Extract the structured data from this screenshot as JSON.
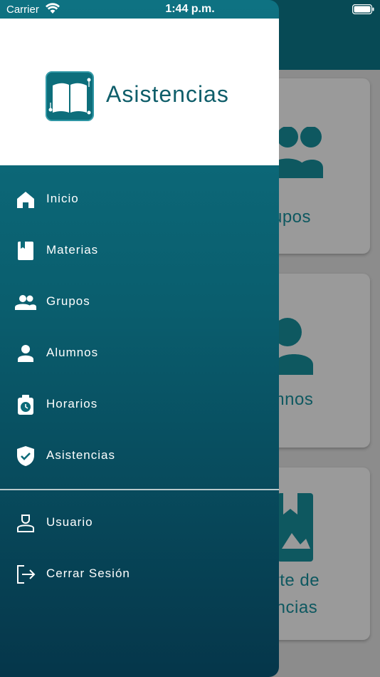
{
  "status_bar": {
    "carrier": "Carrier",
    "time": "1:44 p.m."
  },
  "app": {
    "title": "Asistencias",
    "brand_color": "#0f5e6a",
    "drawer_gradient": [
      "#0e7282",
      "#05364a"
    ]
  },
  "drawer": {
    "items": [
      {
        "label": "Inicio",
        "icon": "home-icon"
      },
      {
        "label": "Materias",
        "icon": "book-icon"
      },
      {
        "label": "Grupos",
        "icon": "group-icon"
      },
      {
        "label": "Alumnos",
        "icon": "person-icon"
      },
      {
        "label": "Horarios",
        "icon": "schedule-icon"
      },
      {
        "label": "Asistencias",
        "icon": "verified-shield-icon"
      }
    ],
    "secondary_items": [
      {
        "label": "Usuario",
        "icon": "user-badge-icon"
      },
      {
        "label": "Cerrar Sesión",
        "icon": "logout-icon"
      }
    ]
  },
  "background_cards": [
    {
      "label_line1": "upos",
      "icon": "group-icon"
    },
    {
      "label_line1": "mnos",
      "icon": "person-icon"
    },
    {
      "label_line1": "orte de",
      "label_line2": "encias",
      "icon": "report-icon"
    }
  ]
}
